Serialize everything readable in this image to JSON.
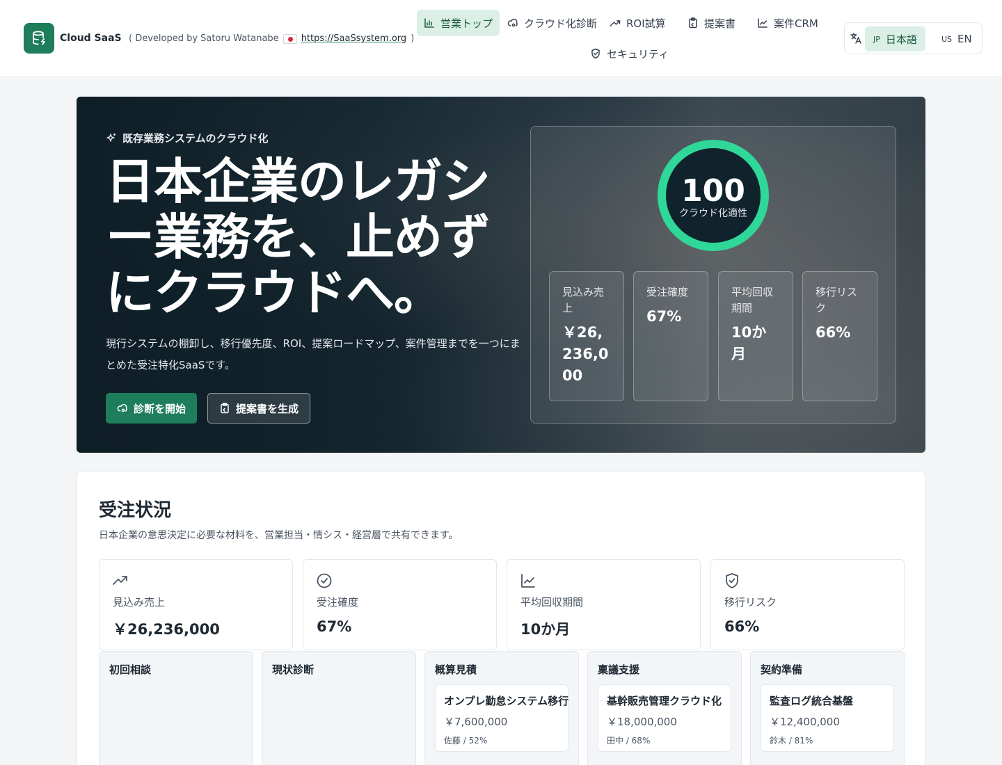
{
  "header": {
    "brand": "Cloud SaaS",
    "developer_prefix": "( Developed by Satoru Watanabe",
    "developer_link": "https://SaaSsystem.org",
    "developer_suffix": ")",
    "nav": [
      {
        "label": "営業トップ",
        "icon": "bar-chart-icon",
        "active": true
      },
      {
        "label": "クラウド化診断",
        "icon": "cloud-cog-icon",
        "active": false
      },
      {
        "label": "ROI試算",
        "icon": "trending-up-icon",
        "active": false
      },
      {
        "label": "提案書",
        "icon": "clipboard-icon",
        "active": false
      },
      {
        "label": "案件CRM",
        "icon": "line-chart-icon",
        "active": false
      },
      {
        "label": "セキュリティ",
        "icon": "shield-check-icon",
        "active": false
      }
    ],
    "languages": [
      {
        "code": "JP",
        "label": "日本語",
        "active": true
      },
      {
        "code": "US",
        "label": "EN",
        "active": false
      }
    ]
  },
  "hero": {
    "eyebrow": "既存業務システムのクラウド化",
    "title": "日本企業のレガシー業務を、止めずにクラウドへ。",
    "description": "現行システムの棚卸し、移行優先度、ROI、提案ロードマップ、案件管理までを一つにまとめた受注特化SaaSです。",
    "primary_button": "診断を開始",
    "secondary_button": "提案書を生成",
    "score": {
      "value": "100",
      "label": "クラウド化適性"
    },
    "metrics": [
      {
        "label": "見込み売上",
        "value": "￥26,236,000"
      },
      {
        "label": "受注確度",
        "value": "67%"
      },
      {
        "label": "平均回収期間",
        "value": "10か月"
      },
      {
        "label": "移行リスク",
        "value": "66%"
      }
    ]
  },
  "orders": {
    "title": "受注状況",
    "subtitle": "日本企業の意思決定に必要な材料を、営業担当・情シス・経営層で共有できます。",
    "kpis": [
      {
        "icon": "trending-up-icon",
        "label": "見込み売上",
        "value": "￥26,236,000"
      },
      {
        "icon": "check-circle-icon",
        "label": "受注確度",
        "value": "67%"
      },
      {
        "icon": "line-chart-icon",
        "label": "平均回収期間",
        "value": "10か月"
      },
      {
        "icon": "shield-check-icon",
        "label": "移行リスク",
        "value": "66%"
      }
    ],
    "stages": [
      {
        "title": "初回相談",
        "deals": []
      },
      {
        "title": "現状診断",
        "deals": []
      },
      {
        "title": "概算見積",
        "deals": [
          {
            "name": "オンプレ勤怠システム移行",
            "amount": "￥7,600,000",
            "meta": "佐藤 / 52%"
          }
        ]
      },
      {
        "title": "稟議支援",
        "deals": [
          {
            "name": "基幹販売管理クラウド化",
            "amount": "￥18,000,000",
            "meta": "田中 / 68%"
          }
        ]
      },
      {
        "title": "契約準備",
        "deals": [
          {
            "name": "監査ログ統合基盤",
            "amount": "￥12,400,000",
            "meta": "鈴木 / 81%"
          }
        ]
      }
    ]
  },
  "colors": {
    "brand": "#1e7d5b",
    "gauge": "#2fd898",
    "active_nav_bg": "#dcefe6"
  }
}
